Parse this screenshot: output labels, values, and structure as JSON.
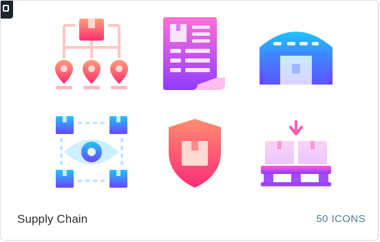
{
  "card": {
    "title": "Supply Chain",
    "count_label": "50 ICONS"
  },
  "icons": [
    "distribution-network-icon",
    "invoice-document-icon",
    "warehouse-icon",
    "package-monitoring-icon",
    "package-protection-icon",
    "pallet-loading-icon"
  ],
  "colors": {
    "gradient_pink_top": "#ff8a7a",
    "gradient_pink_bottom": "#ff2d79",
    "gradient_violet_top": "#ff73e6",
    "gradient_violet_bottom": "#8b3cff",
    "gradient_blue_top": "#1fb6ff",
    "gradient_blue_bottom": "#6b3cff",
    "title_text": "#2b2b2b",
    "count_text": "#4c7891"
  }
}
